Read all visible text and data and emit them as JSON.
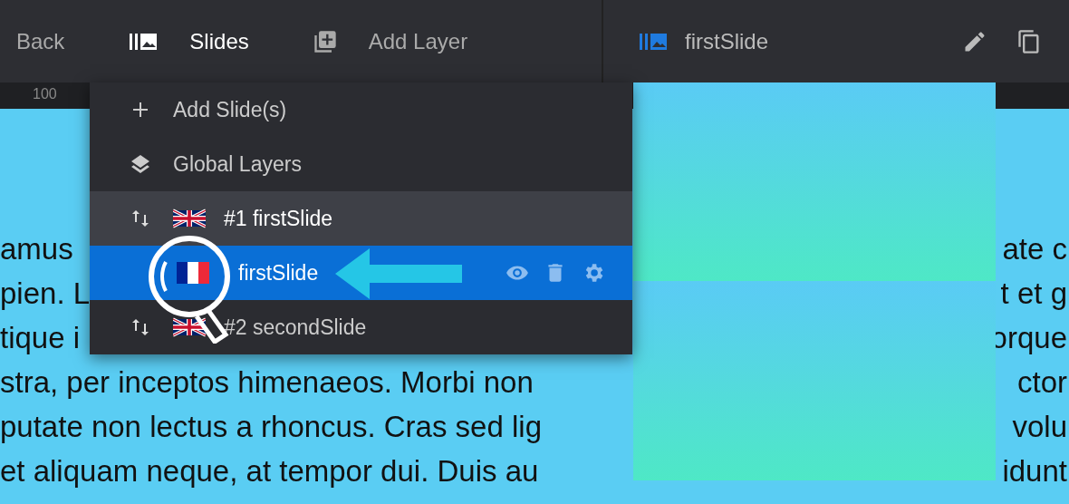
{
  "topbar": {
    "back": "Back",
    "tabs": [
      {
        "label": "Slides",
        "selected": true
      },
      {
        "label": "Add Layer",
        "selected": false
      }
    ],
    "current_slide": "firstSlide"
  },
  "ruler": {
    "label": "100"
  },
  "canvas_text": [
    {
      "left": "amus",
      "right": "ate c"
    },
    {
      "left": "pien. L",
      "right": "t et g"
    },
    {
      "left": "tique i",
      "right": "orque"
    },
    {
      "left": "stra, per inceptos himenaeos. Morbi non",
      "right": "ctor"
    },
    {
      "left": "putate non lectus a rhoncus. Cras sed lig",
      "right": "volu"
    },
    {
      "left": "et aliquam neque, at tempor dui. Duis au",
      "right": "idunt"
    }
  ],
  "menu": {
    "items": [
      {
        "kind": "add",
        "label": "Add Slide(s)"
      },
      {
        "kind": "global",
        "label": "Global Layers"
      },
      {
        "kind": "slide",
        "label": "#1 firstSlide",
        "expanded": true,
        "children": [
          {
            "label": "firstSlide",
            "selected": true
          }
        ]
      },
      {
        "kind": "slide",
        "label": "#2 secondSlide",
        "expanded": false
      }
    ]
  }
}
